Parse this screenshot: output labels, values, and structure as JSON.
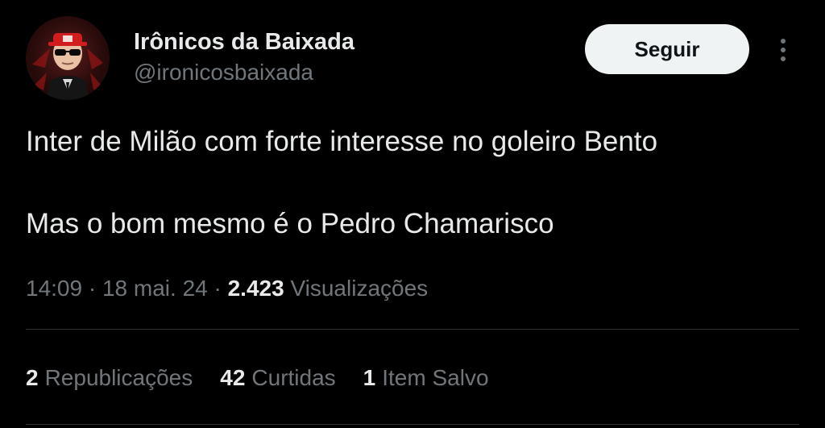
{
  "author": {
    "display_name": "Irônicos da Baixada",
    "handle": "@ironicosbaixada",
    "avatar_icon": "profile-avatar"
  },
  "actions": {
    "follow_label": "Seguir",
    "more_icon": "more-vertical-icon"
  },
  "tweet": {
    "lines": [
      "Inter de Milão com forte interesse no goleiro Bento",
      "Mas o bom mesmo é o Pedro Chamarisco"
    ]
  },
  "meta": {
    "time": "14:09",
    "separator": "·",
    "date": "18 mai. 24",
    "views_count": "2.423",
    "views_label": "Visualizações"
  },
  "stats": {
    "reposts_count": "2",
    "reposts_label": "Republicações",
    "likes_count": "42",
    "likes_label": "Curtidas",
    "saves_count": "1",
    "saves_label": "Item Salvo"
  },
  "colors": {
    "background": "#000000",
    "primary_text": "#e7e9ea",
    "secondary_text": "#71767b",
    "divider": "#2f3336",
    "button_bg": "#eff3f4"
  }
}
